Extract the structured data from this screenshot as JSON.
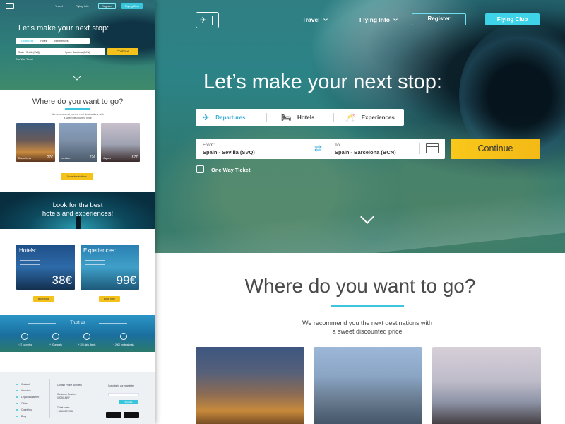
{
  "nav": {
    "travel": "Travel",
    "flying_info": "Flying Info",
    "register": "Register",
    "flying_club": "Flying Club"
  },
  "hero": {
    "headline": "Let’s make your next stop:",
    "tabs": [
      "Departures",
      "Hotels",
      "Experiences"
    ],
    "from_label": "From:",
    "from_value": "Spain - Sevilla (SVQ)",
    "to_label": "To:",
    "to_value": "Spain - Barcelona (BCN)",
    "continue": "Continue",
    "one_way": "One Way Ticket"
  },
  "destinations": {
    "title": "Where do you want to go?",
    "subtitle_line1": "We recommend you the next destinations with",
    "subtitle_line2": "a sweet discounted price",
    "cards": [
      {
        "name": "Barcelona",
        "price": "27€"
      },
      {
        "name": "London",
        "price": "22€"
      },
      {
        "name": "Japan",
        "price": "87€"
      }
    ],
    "more": "More destinations"
  },
  "mini": {
    "oneway": "One Way Ticket",
    "tabs": [
      "Departures",
      "Hotels",
      "Experiences"
    ],
    "look_line1": "Look for the best",
    "look_line2": "hotels and experiences!",
    "hotels_title": "Hotels:",
    "hotels_price": "38€",
    "exp_title": "Experiences:",
    "exp_price": "99€",
    "book_now": "Book now!",
    "trust_title": "Trust us",
    "trust_items": [
      "+ 87 countries",
      "+ 20 airports",
      "+ 200 daily flights",
      "+ 2000 professionals"
    ],
    "footer_links": [
      "Contact",
      "About us",
      "Legal disclaimer",
      "Cities",
      "Countries",
      "Blog"
    ],
    "contact_title": "Contact Phone Numbers",
    "contact_lines": [
      "Customer Services:",
      "0202614597",
      "Ticket sales:",
      "+440665076008"
    ],
    "newsletter_title": "Suscribe to our newsletter",
    "newsletter_btn": "Suscribe",
    "route_from": "Spain - Sevilla (SVQ)",
    "route_to": "Spain - Barcelona (BCN)"
  }
}
